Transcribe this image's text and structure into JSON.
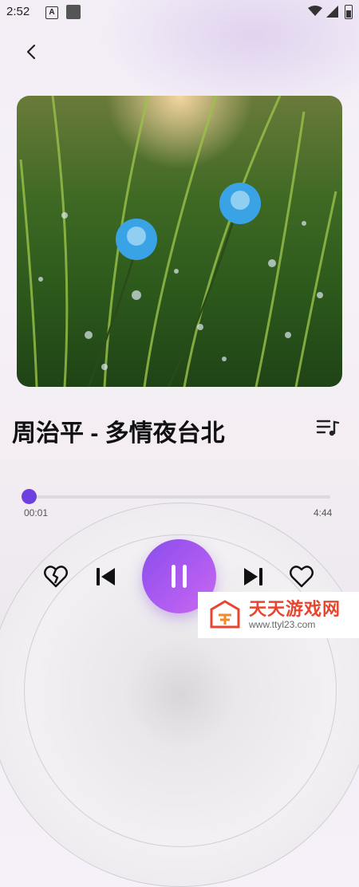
{
  "status_bar": {
    "time": "2:52",
    "a_icon_letter": "A"
  },
  "header": {
    "back_icon": "chevron-left-icon"
  },
  "album_cover": {
    "description_icon": "album-art"
  },
  "song": {
    "title": "周治平 - 多情夜台北",
    "playlist_icon": "playlist-music-icon"
  },
  "progress": {
    "current": "00:01",
    "total": "4:44",
    "fraction": 0.004
  },
  "controls": {
    "dislike_icon": "broken-heart-icon",
    "prev_icon": "skip-previous-icon",
    "play_state": "pause",
    "next_icon": "skip-next-icon",
    "like_icon": "heart-icon"
  },
  "colors": {
    "accent": "#6e3fe0",
    "play_gradient_end": "#c969f0",
    "watermark_red": "#e8452f"
  },
  "watermark": {
    "name": "天天游戏网",
    "url": "www.ttyl23.com"
  }
}
